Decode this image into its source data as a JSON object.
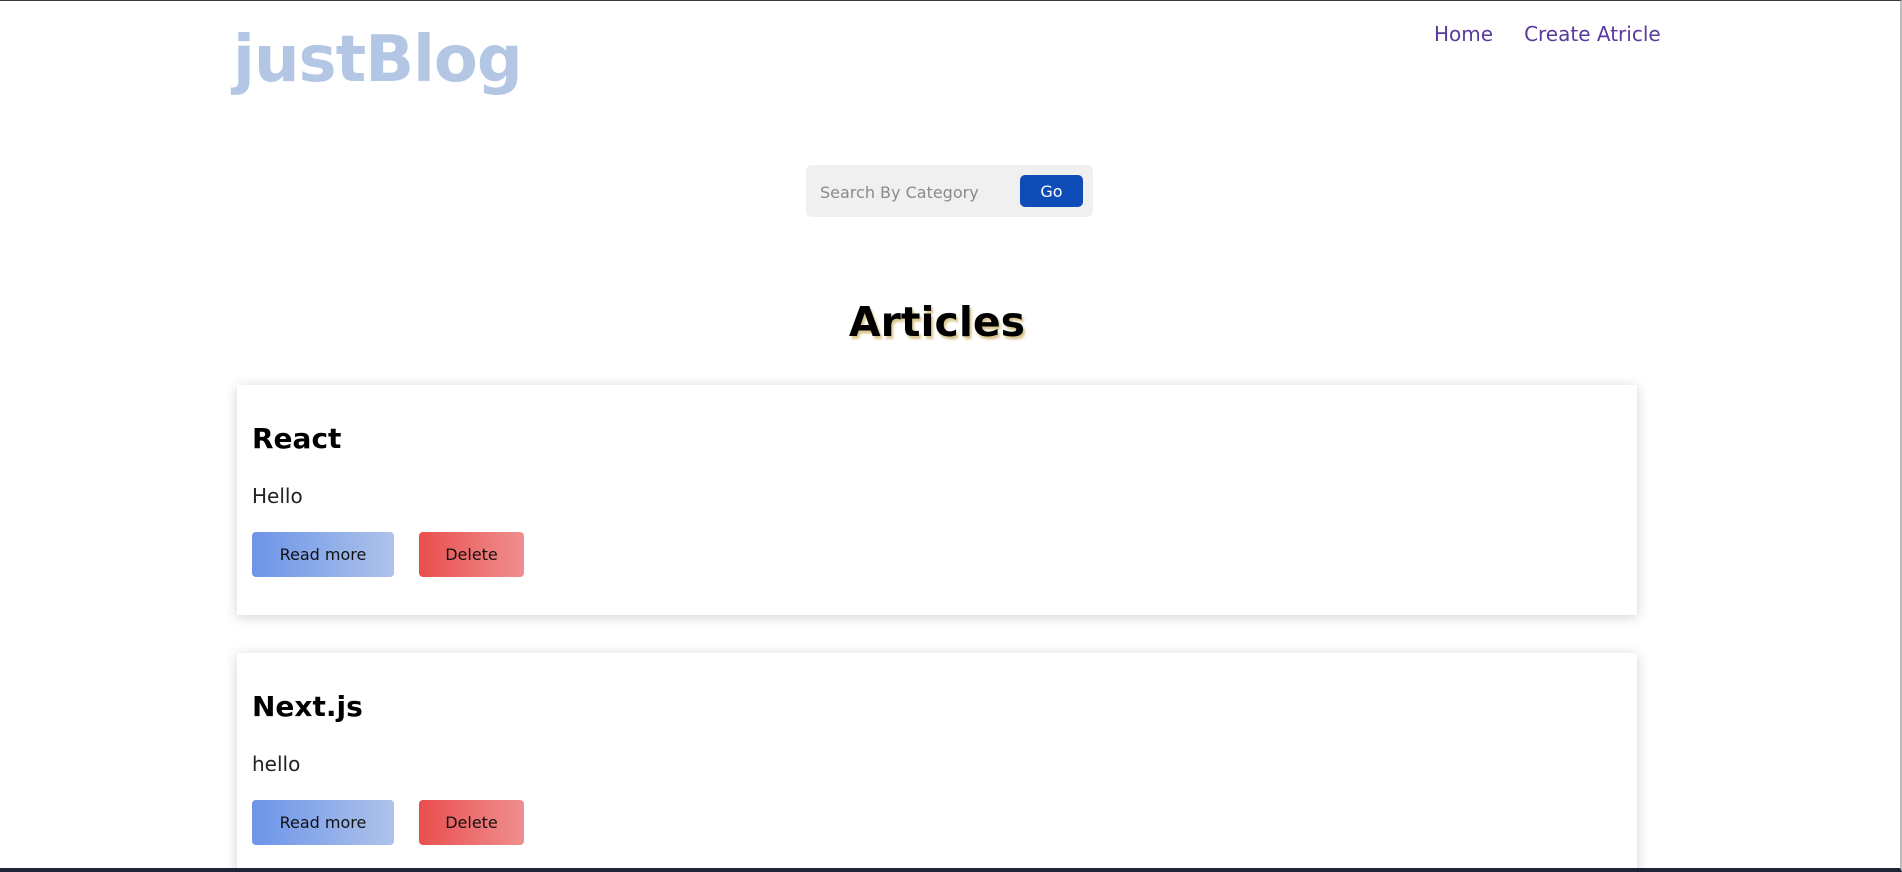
{
  "header": {
    "logo": "justBlog",
    "nav": [
      {
        "label": "Home"
      },
      {
        "label": "Create Atricle"
      }
    ]
  },
  "search": {
    "placeholder": "Search By Category",
    "value": "",
    "button_label": "Go"
  },
  "main": {
    "heading": "Articles",
    "articles": [
      {
        "title": "React",
        "body": "Hello",
        "read_more_label": "Read more",
        "delete_label": "Delete"
      },
      {
        "title": "Next.js",
        "body": "hello",
        "read_more_label": "Read more",
        "delete_label": "Delete"
      }
    ]
  },
  "colors": {
    "logo": "#b3c6e3",
    "nav_link": "#5a3a9a",
    "go_button": "#0e4db8",
    "read_more_gradient": [
      "#6c94e8",
      "#aec3ea"
    ],
    "delete_gradient": [
      "#ea4e4e",
      "#ef8f8f"
    ]
  }
}
